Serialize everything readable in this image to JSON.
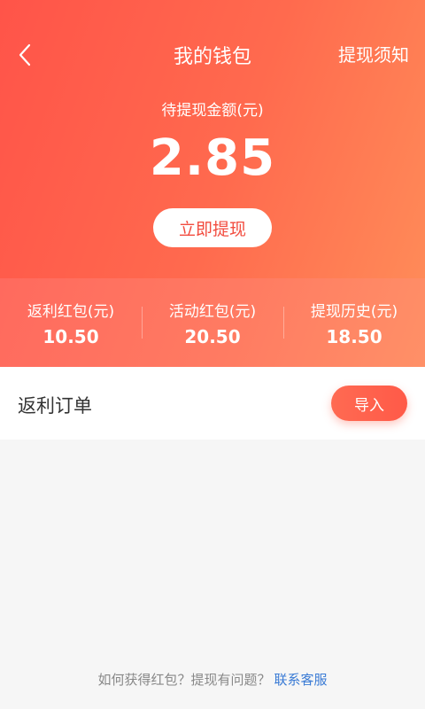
{
  "header": {
    "title": "我的钱包",
    "notice_link": "提现须知",
    "back_icon": "chevron-left-icon"
  },
  "pending": {
    "label": "待提现金额(元)",
    "amount": "2.85",
    "withdraw_button": "立即提现"
  },
  "stats": [
    {
      "label": "返利红包(元)",
      "value": "10.50"
    },
    {
      "label": "活动红包(元)",
      "value": "20.50"
    },
    {
      "label": "提现历史(元)",
      "value": "18.50"
    }
  ],
  "orders": {
    "title": "返利订单",
    "import_button": "导入"
  },
  "footer": {
    "question": "如何获得红包？提现有问题？",
    "contact": "联系客服"
  },
  "colors": {
    "accent": "#ff5449",
    "link": "#3a7bd5"
  }
}
